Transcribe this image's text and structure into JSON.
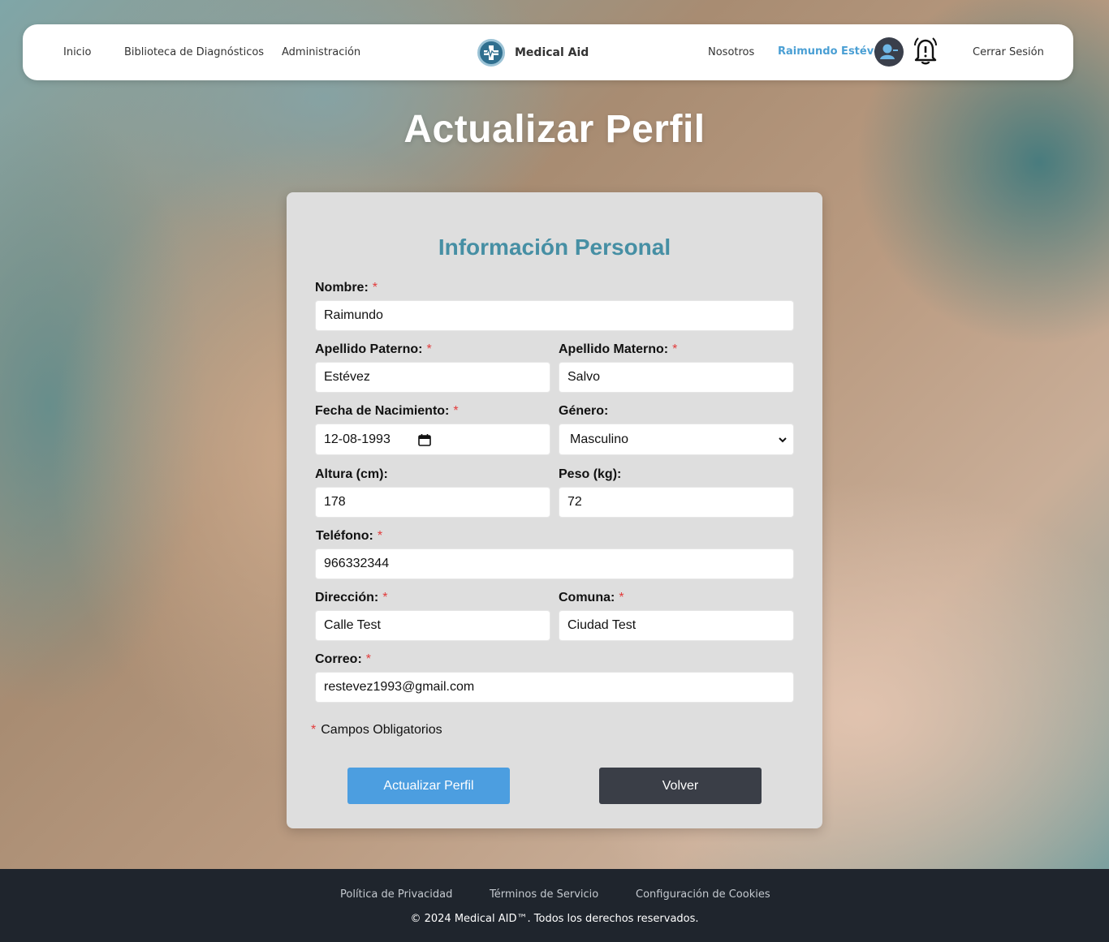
{
  "nav": {
    "links": [
      "Inicio",
      "Biblioteca de Diagnósticos",
      "Administración"
    ],
    "brand": "Medical Aid",
    "about": "Nosotros",
    "user_name": "Raimundo Estévez",
    "logout": "Cerrar Sesión",
    "icons": [
      "medical-logo-icon",
      "user-avatar-icon",
      "notification-bell-icon"
    ]
  },
  "page_title": "Actualizar Perfil",
  "form": {
    "section_title": "Información Personal",
    "required_mark": "*",
    "fields": {
      "nombre": {
        "label": "Nombre:",
        "value": "Raimundo"
      },
      "apellido_paterno": {
        "label": "Apellido Paterno:",
        "value": "Estévez"
      },
      "apellido_materno": {
        "label": "Apellido Materno:",
        "value": "Salvo"
      },
      "fecha_nacimiento": {
        "label": "Fecha de Nacimiento:",
        "value": "12-08-1993"
      },
      "genero": {
        "label": "Género:",
        "value": "Masculino"
      },
      "altura": {
        "label": "Altura (cm):",
        "value": "178"
      },
      "peso": {
        "label": "Peso (kg):",
        "value": "72"
      },
      "telefono": {
        "label": "Teléfono:",
        "value": "966332344"
      },
      "direccion": {
        "label": "Dirección:",
        "value": "Calle Test"
      },
      "comuna": {
        "label": "Comuna:",
        "value": "Ciudad Test"
      },
      "correo": {
        "label": "Correo:",
        "value": "restevez1993@gmail.com"
      }
    },
    "required_note": "Campos Obligatorios",
    "submit_label": "Actualizar Perfil",
    "back_label": "Volver"
  },
  "footer": {
    "links": [
      "Política de Privacidad",
      "Términos de Servicio",
      "Configuración de Cookies"
    ],
    "copyright": "© 2024 Medical AID™. Todos los derechos reservados."
  },
  "colors": {
    "accent": "#4c9ee0",
    "section_title": "#468fa4",
    "user_name": "#4a9fd4",
    "required": "#e23b3b",
    "footer_bg": "#1f252d",
    "dark_button": "#3a3e47"
  }
}
